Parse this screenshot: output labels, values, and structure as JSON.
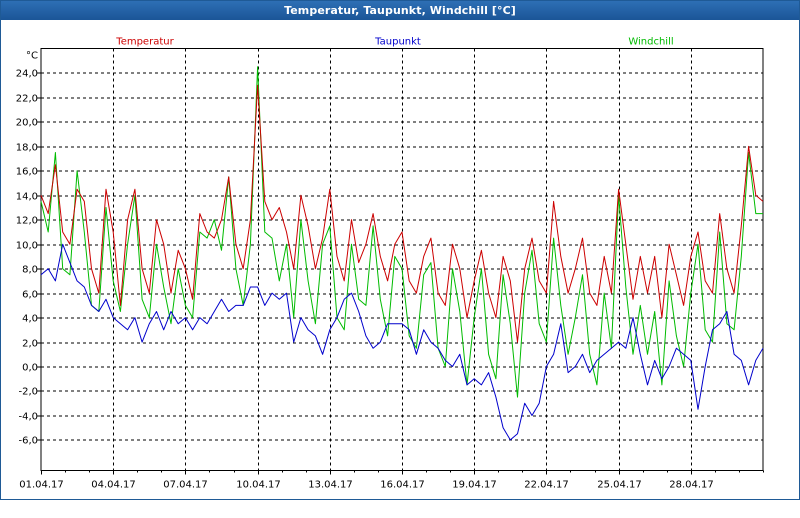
{
  "title": "Temperatur, Taupunkt, Windchill [°C]",
  "colors": {
    "temperatur": "#cc0000",
    "taupunkt": "#0000cc",
    "windchill": "#00bb00",
    "title_bg": "#1b5597",
    "grid": "#000000"
  },
  "chart_data": {
    "type": "line",
    "title": "Temperatur, Taupunkt, Windchill [°C]",
    "unit": "°C",
    "xlabel": "",
    "ylabel": "°C",
    "ylim": [
      -8.5,
      26.0
    ],
    "xlim": [
      0,
      30
    ],
    "grid": true,
    "legend_placement": "top",
    "x_tick_labels": [
      {
        "x": 0,
        "label": "01.04.17"
      },
      {
        "x": 3,
        "label": "04.04.17"
      },
      {
        "x": 6,
        "label": "07.04.17"
      },
      {
        "x": 9,
        "label": "10.04.17"
      },
      {
        "x": 12,
        "label": "13.04.17"
      },
      {
        "x": 15,
        "label": "16.04.17"
      },
      {
        "x": 18,
        "label": "19.04.17"
      },
      {
        "x": 21,
        "label": "22.04.17"
      },
      {
        "x": 24,
        "label": "25.04.17"
      },
      {
        "x": 27,
        "label": "28.04.17"
      }
    ],
    "y_ticks": [
      24,
      22,
      20,
      18,
      16,
      14,
      12,
      10,
      8,
      6,
      4,
      2,
      0,
      -2,
      -4,
      -6
    ],
    "y_tick_labels": [
      "24,0",
      "22,0",
      "20,0",
      "18,0",
      "16,0",
      "14,0",
      "12,0",
      "10,0",
      "8,0",
      "6,0",
      "4,0",
      "2,0",
      "0,0",
      "-2,0",
      "-4,0",
      "-6,0"
    ],
    "series": [
      {
        "name": "Temperatur",
        "x": [
          0,
          0.3,
          0.6,
          0.9,
          1.2,
          1.5,
          1.8,
          2.1,
          2.4,
          2.7,
          3,
          3.3,
          3.6,
          3.9,
          4.2,
          4.5,
          4.8,
          5.1,
          5.4,
          5.7,
          6,
          6.3,
          6.6,
          6.9,
          7.2,
          7.5,
          7.8,
          8.1,
          8.4,
          8.7,
          9,
          9.3,
          9.6,
          9.9,
          10.2,
          10.5,
          10.8,
          11.1,
          11.4,
          11.7,
          12,
          12.3,
          12.6,
          12.9,
          13.2,
          13.5,
          13.8,
          14.1,
          14.4,
          14.7,
          15,
          15.3,
          15.6,
          15.9,
          16.2,
          16.5,
          16.8,
          17.1,
          17.4,
          17.7,
          18,
          18.3,
          18.6,
          18.9,
          19.2,
          19.5,
          19.8,
          20.1,
          20.4,
          20.7,
          21,
          21.3,
          21.6,
          21.9,
          22.2,
          22.5,
          22.8,
          23.1,
          23.4,
          23.7,
          24,
          24.3,
          24.6,
          24.9,
          25.2,
          25.5,
          25.8,
          26.1,
          26.4,
          26.7,
          27,
          27.3,
          27.6,
          27.9,
          28.2,
          28.5,
          28.8,
          29.1,
          29.4,
          29.7,
          30
        ],
        "values": [
          14.0,
          12.5,
          16.5,
          11.0,
          10.0,
          14.5,
          13.5,
          8.0,
          6.0,
          14.5,
          11.0,
          5.0,
          12.0,
          14.5,
          8.0,
          6.0,
          12.0,
          10.0,
          6.0,
          9.5,
          8.0,
          5.5,
          12.5,
          11.0,
          10.5,
          12.0,
          15.5,
          10.0,
          8.0,
          12.0,
          23.0,
          13.5,
          12.0,
          13.0,
          11.0,
          8.0,
          14.0,
          11.5,
          8.0,
          10.5,
          14.5,
          9.0,
          7.0,
          12.0,
          8.5,
          10.0,
          12.5,
          9.0,
          7.0,
          10.0,
          11.0,
          7.0,
          6.0,
          9.0,
          10.5,
          6.0,
          5.0,
          10.0,
          8.0,
          4.0,
          7.0,
          9.5,
          6.0,
          4.0,
          9.0,
          7.0,
          2.0,
          8.0,
          10.5,
          7.0,
          6.0,
          13.5,
          9.0,
          6.0,
          8.0,
          10.5,
          6.0,
          5.0,
          9.0,
          6.0,
          14.5,
          10.0,
          5.5,
          9.0,
          6.0,
          9.0,
          4.0,
          10.0,
          7.5,
          5.0,
          9.0,
          11.0,
          7.0,
          6.0,
          12.5,
          8.0,
          6.0,
          11.5,
          18.0,
          14.0,
          13.5
        ]
      },
      {
        "name": "Taupunkt",
        "x": [
          0,
          0.3,
          0.6,
          0.9,
          1.2,
          1.5,
          1.8,
          2.1,
          2.4,
          2.7,
          3,
          3.3,
          3.6,
          3.9,
          4.2,
          4.5,
          4.8,
          5.1,
          5.4,
          5.7,
          6,
          6.3,
          6.6,
          6.9,
          7.2,
          7.5,
          7.8,
          8.1,
          8.4,
          8.7,
          9,
          9.3,
          9.6,
          9.9,
          10.2,
          10.5,
          10.8,
          11.1,
          11.4,
          11.7,
          12,
          12.3,
          12.6,
          12.9,
          13.2,
          13.5,
          13.8,
          14.1,
          14.4,
          14.7,
          15,
          15.3,
          15.6,
          15.9,
          16.2,
          16.5,
          16.8,
          17.1,
          17.4,
          17.7,
          18,
          18.3,
          18.6,
          18.9,
          19.2,
          19.5,
          19.8,
          20.1,
          20.4,
          20.7,
          21,
          21.3,
          21.6,
          21.9,
          22.2,
          22.5,
          22.8,
          23.1,
          23.4,
          23.7,
          24,
          24.3,
          24.6,
          24.9,
          25.2,
          25.5,
          25.8,
          26.1,
          26.4,
          26.7,
          27,
          27.3,
          27.6,
          27.9,
          28.2,
          28.5,
          28.8,
          29.1,
          29.4,
          29.7,
          30
        ],
        "values": [
          7.5,
          8.0,
          7.0,
          10.0,
          8.5,
          7.0,
          6.5,
          5.0,
          4.5,
          5.5,
          4.0,
          3.5,
          3.0,
          4.0,
          2.0,
          3.5,
          4.5,
          3.0,
          4.5,
          3.5,
          4.0,
          3.0,
          4.0,
          3.5,
          4.5,
          5.5,
          4.5,
          5.0,
          5.0,
          6.5,
          6.5,
          5.0,
          6.0,
          5.5,
          6.0,
          2.0,
          4.0,
          3.0,
          2.5,
          1.0,
          3.0,
          4.0,
          5.5,
          6.0,
          4.5,
          2.5,
          1.5,
          2.0,
          3.5,
          3.5,
          3.5,
          3.0,
          1.0,
          3.0,
          2.0,
          1.5,
          0.5,
          0.0,
          1.0,
          -1.5,
          -1.0,
          -1.5,
          -0.5,
          -2.5,
          -5.0,
          -6.0,
          -5.5,
          -3.0,
          -4.0,
          -3.0,
          0.0,
          1.0,
          3.5,
          -0.5,
          0.0,
          1.0,
          -0.5,
          0.5,
          1.0,
          1.5,
          2.0,
          1.5,
          4.0,
          1.0,
          -1.5,
          0.5,
          -1.0,
          0.0,
          1.5,
          1.0,
          0.5,
          -3.5,
          0.0,
          3.0,
          3.5,
          4.5,
          1.0,
          0.5,
          -1.5,
          0.5,
          1.5
        ]
      },
      {
        "name": "Windchill",
        "x": [
          0,
          0.3,
          0.6,
          0.9,
          1.2,
          1.5,
          1.8,
          2.1,
          2.4,
          2.7,
          3,
          3.3,
          3.6,
          3.9,
          4.2,
          4.5,
          4.8,
          5.1,
          5.4,
          5.7,
          6,
          6.3,
          6.6,
          6.9,
          7.2,
          7.5,
          7.8,
          8.1,
          8.4,
          8.7,
          9,
          9.3,
          9.6,
          9.9,
          10.2,
          10.5,
          10.8,
          11.1,
          11.4,
          11.7,
          12,
          12.3,
          12.6,
          12.9,
          13.2,
          13.5,
          13.8,
          14.1,
          14.4,
          14.7,
          15,
          15.3,
          15.6,
          15.9,
          16.2,
          16.5,
          16.8,
          17.1,
          17.4,
          17.7,
          18,
          18.3,
          18.6,
          18.9,
          19.2,
          19.5,
          19.8,
          20.1,
          20.4,
          20.7,
          21,
          21.3,
          21.6,
          21.9,
          22.2,
          22.5,
          22.8,
          23.1,
          23.4,
          23.7,
          24,
          24.3,
          24.6,
          24.9,
          25.2,
          25.5,
          25.8,
          26.1,
          26.4,
          26.7,
          27,
          27.3,
          27.6,
          27.9,
          28.2,
          28.5,
          28.8,
          29.1,
          29.4,
          29.7,
          30
        ],
        "values": [
          13.5,
          11.0,
          17.5,
          8.0,
          7.5,
          16.0,
          11.0,
          5.0,
          4.5,
          13.0,
          7.0,
          4.5,
          10.0,
          14.0,
          5.5,
          4.0,
          10.0,
          6.5,
          3.5,
          8.0,
          5.0,
          4.0,
          11.0,
          10.5,
          12.0,
          9.5,
          15.5,
          8.0,
          5.0,
          10.0,
          24.5,
          11.0,
          10.5,
          7.0,
          10.0,
          4.0,
          12.0,
          7.0,
          3.5,
          10.0,
          11.5,
          4.0,
          3.0,
          10.0,
          5.5,
          5.0,
          11.5,
          5.5,
          2.5,
          9.0,
          8.0,
          2.5,
          1.5,
          7.5,
          8.5,
          1.5,
          0.0,
          8.0,
          4.5,
          -1.5,
          4.0,
          8.0,
          1.0,
          -1.0,
          7.5,
          3.5,
          -2.5,
          6.0,
          9.5,
          3.5,
          2.0,
          10.5,
          5.0,
          1.0,
          4.0,
          7.5,
          1.0,
          -1.5,
          6.0,
          1.5,
          14.0,
          6.5,
          1.0,
          5.0,
          1.0,
          4.5,
          -1.5,
          7.0,
          2.5,
          0.0,
          6.0,
          10.0,
          3.0,
          2.0,
          11.0,
          3.5,
          3.0,
          9.0,
          17.5,
          12.5,
          12.5
        ]
      }
    ]
  }
}
